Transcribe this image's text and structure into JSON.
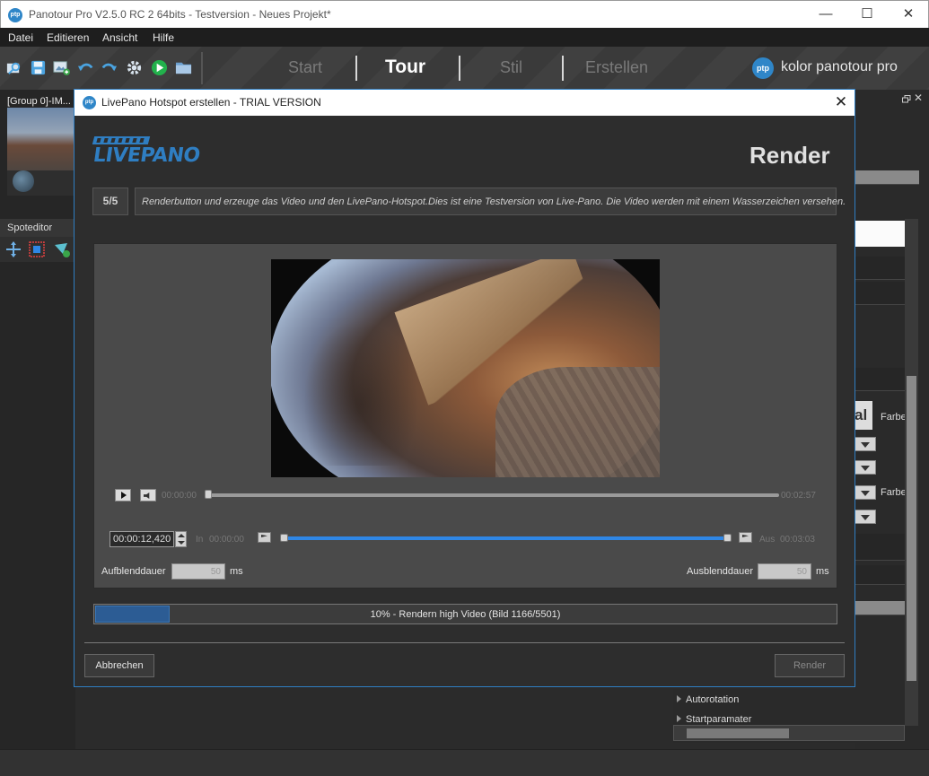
{
  "window": {
    "title": "Panotour Pro V2.5.0 RC 2 64bits - Testversion - Neues Projekt*",
    "app_icon": "ptp",
    "controls": {
      "minimize": "—",
      "maximize": "☐",
      "close": "✕"
    }
  },
  "menubar": {
    "items": [
      "Datei",
      "Editieren",
      "Ansicht",
      "Hilfe"
    ]
  },
  "toolbar": {
    "icons": [
      "open-project-icon",
      "save-icon",
      "add-image-icon",
      "undo-icon",
      "redo-icon",
      "settings-icon",
      "play-icon",
      "folder-icon"
    ],
    "tabs": [
      {
        "label": "Start",
        "active": false
      },
      {
        "label": "Tour",
        "active": true
      },
      {
        "label": "Stil",
        "active": false
      },
      {
        "label": "Erstellen",
        "active": false
      }
    ],
    "brand": {
      "logo": "ptp",
      "text": "kolor panotour pro"
    }
  },
  "left_panel": {
    "group_label": "[Group 0]-IM...",
    "spoteditor_label": "Spoteditor"
  },
  "right_panel": {
    "al_text": "al",
    "farbe_label_1": "Farbe",
    "farbe_label_2": "Farbe",
    "props": [
      "Autorotation",
      "Startparamater"
    ]
  },
  "dialog": {
    "title": "LivePano Hotspot erstellen - TRIAL VERSION",
    "close": "✕",
    "logo_text": "LIVEPANO",
    "heading": "Render",
    "step": "5/5",
    "step_text": "Renderbutton und erzeuge das Video und den LivePano-Hotspot.Dies ist eine Testversion von Live-Pano. Die Video werden mit einem Wasserzeichen versehen.",
    "player": {
      "current_time": "00:00:00",
      "total_time": "00:02:57",
      "playback_position": 0.0
    },
    "trim": {
      "timecode": "00:00:12,420",
      "in_label": "In",
      "in_time": "00:00:00",
      "out_label": "Aus",
      "out_time": "00:03:03"
    },
    "fade_in": {
      "label": "Aufblenddauer",
      "value": "50",
      "unit": "ms"
    },
    "fade_out": {
      "label": "Ausblenddauer",
      "value": "50",
      "unit": "ms"
    },
    "progress": {
      "percent": 10,
      "text": "10% - Rendern high Video (Bild 1166/5501)"
    },
    "buttons": {
      "cancel": "Abbrechen",
      "render": "Render"
    }
  },
  "colors": {
    "accent": "#2f7ec2",
    "range_blue": "#2f87e6",
    "progress_fill": "#2c5c94"
  }
}
